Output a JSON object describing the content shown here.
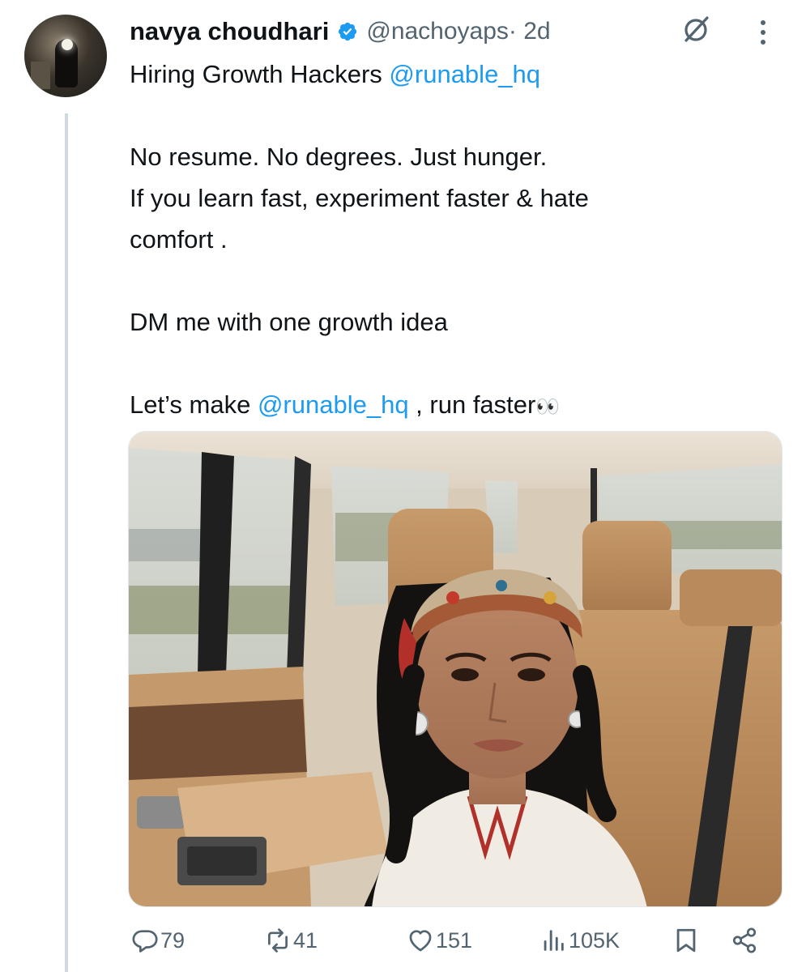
{
  "author": {
    "display_name": "navya choudhari",
    "handle": "@nachoyaps",
    "time": " · 2d"
  },
  "tweet": {
    "line1_prefix": "Hiring Growth Hackers ",
    "line1_mention": "@runable_hq",
    "line2": "No resume. No degrees. Just hunger.",
    "line3": "If you learn fast, experiment faster & hate",
    "line4": "comfort .",
    "line5": "DM me with one growth idea",
    "line6_prefix": "Let’s make ",
    "line6_mention": "@runable_hq",
    "line6_suffix": " , run faster",
    "line6_emoji": "👀"
  },
  "actions": {
    "replies": "79",
    "reposts": "41",
    "likes": "151",
    "views": "105K"
  },
  "colors": {
    "accent": "#1d9bf0",
    "secondary_text": "#536471",
    "primary_text": "#0f1419"
  },
  "icons": [
    "verified-badge-icon",
    "grok-icon",
    "more-options-icon",
    "reply-icon",
    "repost-icon",
    "like-icon",
    "views-icon",
    "bookmark-icon",
    "share-icon"
  ]
}
